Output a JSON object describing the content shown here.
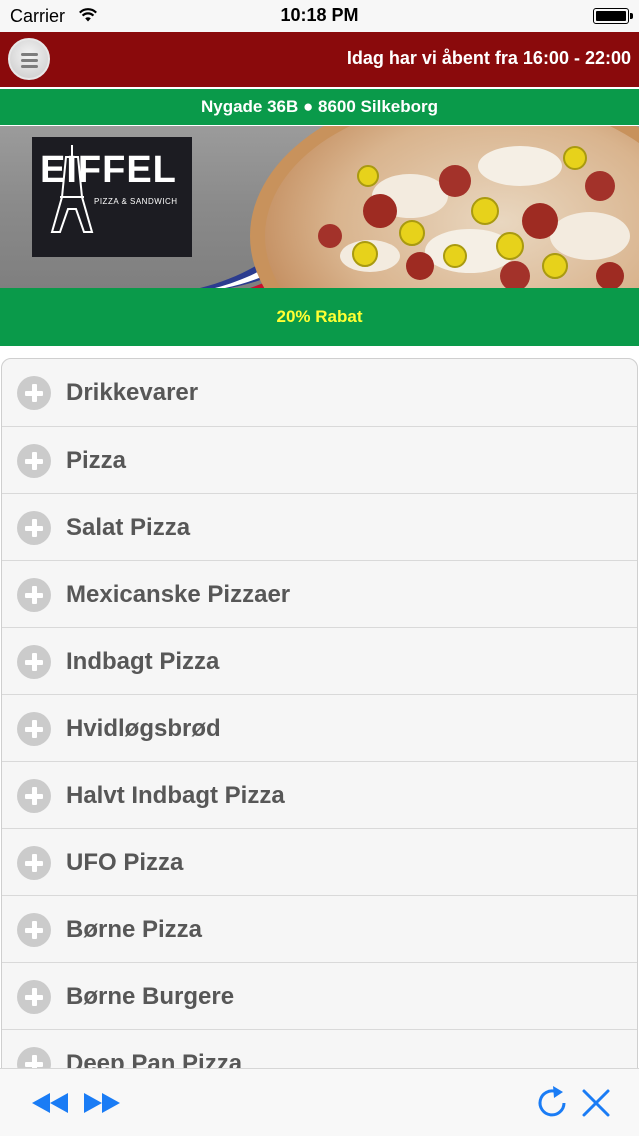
{
  "status_bar": {
    "carrier": "Carrier",
    "time": "10:18 PM"
  },
  "header": {
    "hours_text": "Idag har vi åbent fra 16:00 - 22:00"
  },
  "address": {
    "text": "Nygade 36B ● 8600 Silkeborg"
  },
  "banner": {
    "logo_title": "EIFFEL",
    "logo_subtitle": "PIZZA & SANDWICH"
  },
  "discount": {
    "text": "20% Rabat"
  },
  "categories": [
    "Drikkevarer",
    "Pizza",
    "Salat Pizza",
    "Mexicanske Pizzaer",
    "Indbagt Pizza",
    "Hvidløgsbrød",
    "Halvt Indbagt Pizza",
    "UFO Pizza",
    "Børne Pizza",
    "Børne Burgere",
    "Deep Pan Pizza"
  ],
  "colors": {
    "header_red": "#8a0a0c",
    "brand_green": "#0a9a4a",
    "discount_yellow": "#ffff33",
    "ios_blue": "#1a7cf5"
  },
  "icons": {
    "menu": "hamburger-menu-icon",
    "row": "plus-circle-icon",
    "back": "rewind-icon",
    "forward": "fast-forward-icon",
    "reload": "reload-icon",
    "close": "close-icon"
  }
}
